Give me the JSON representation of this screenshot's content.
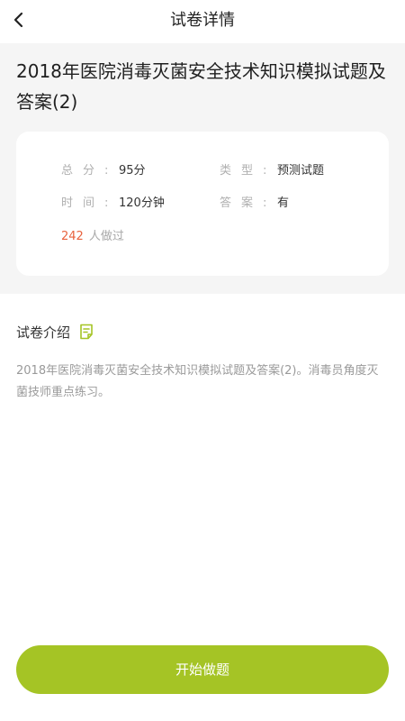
{
  "header": {
    "title": "试卷详情"
  },
  "paper": {
    "title": "2018年医院消毒灭菌安全技术知识模拟试题及答案(2)",
    "total_label": "总分:",
    "total_value": "95分",
    "type_label": "类型:",
    "type_value": "预测试题",
    "time_label": "时间:",
    "time_value": "120分钟",
    "answer_label": "答案:",
    "answer_value": "有",
    "done_count": "242",
    "done_text": "人做过"
  },
  "intro": {
    "title": "试卷介绍",
    "description": "2018年医院消毒灭菌安全技术知识模拟试题及答案(2)。消毒员角度灭菌技师重点练习。"
  },
  "actions": {
    "start_label": "开始做题"
  },
  "colors": {
    "accent": "#a5c425",
    "count": "#e8623d",
    "icon": "#a5c425"
  }
}
